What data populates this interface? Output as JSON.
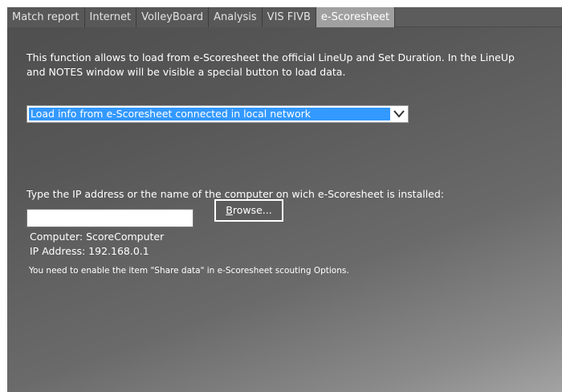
{
  "tabs": [
    {
      "label": "Match report",
      "active": false
    },
    {
      "label": "Internet",
      "active": false
    },
    {
      "label": "VolleyBoard",
      "active": false
    },
    {
      "label": "Analysis",
      "active": false
    },
    {
      "label": "VIS FIVB",
      "active": false
    },
    {
      "label": "e-Scoresheet",
      "active": true
    }
  ],
  "description": "This function allows to load from e-Scoresheet the official LineUp and Set Duration. In the LineUp and NOTES window will be visible a special button to load data.",
  "source_select": {
    "selected": "Load info from e-Scoresheet connected in local network",
    "arrow_icon": "chevron-down-icon"
  },
  "ip_section": {
    "label": "Type the IP address or the name of the computer on wich e-Scoresheet is installed:",
    "input_value": "",
    "browse_label_underlined": "B",
    "browse_label_rest": "rowse..."
  },
  "computer_info": {
    "computer": "Computer: ScoreComputer",
    "ip_address": "IP Address: 192.168.0.1"
  },
  "note": "You need to enable the item \"Share data\" in e-Scoresheet scouting Options.",
  "colors": {
    "selection_blue": "#3399ff",
    "active_tab": "#a0a0a0",
    "panel_dark": "#4e4e4e"
  }
}
